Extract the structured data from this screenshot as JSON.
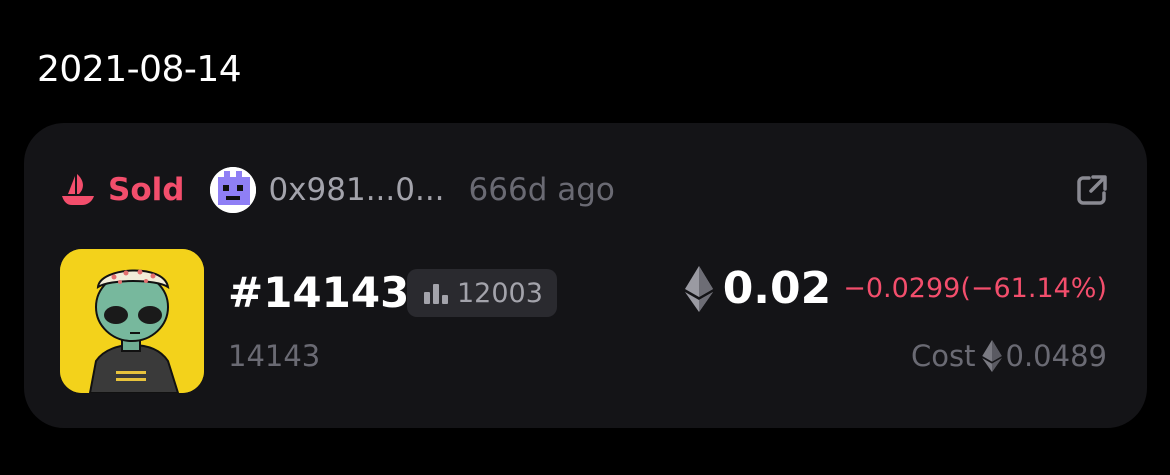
{
  "date_header": "2021-08-14",
  "activity": {
    "event_icon": "opensea-boat-icon",
    "event_label": "Sold",
    "event_color": "#f34e6c",
    "address": "0x981...0...",
    "time_ago": "666d ago",
    "external_link_icon": "external-link-icon"
  },
  "token": {
    "title": "#14143",
    "rank_icon": "bar-chart-icon",
    "rank": "12003",
    "subtitle": "14143",
    "thumbnail_bg": "#f3d21b"
  },
  "price": {
    "currency_icon": "ethereum-icon",
    "value": "0.02",
    "change": "−0.0299(−61.14%)",
    "cost_label": "Cost",
    "cost_value": "0.0489"
  }
}
